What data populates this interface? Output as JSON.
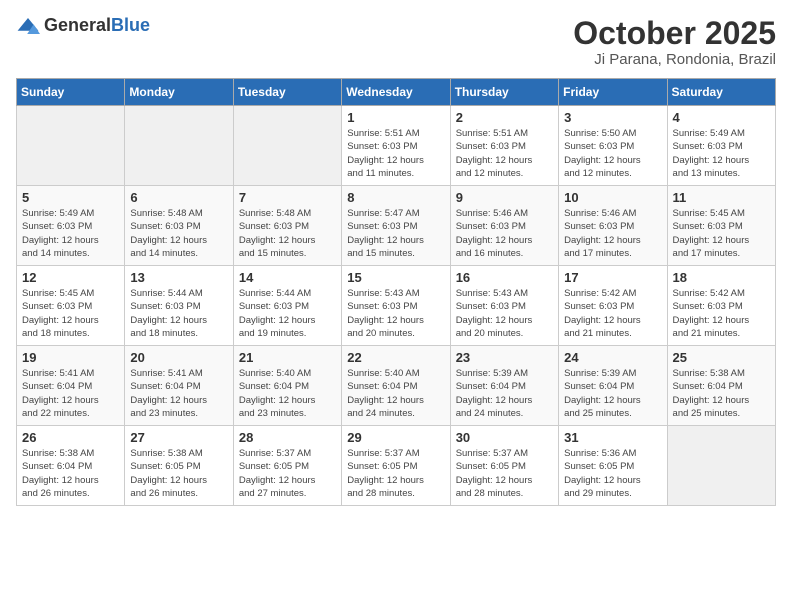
{
  "logo": {
    "general": "General",
    "blue": "Blue"
  },
  "header": {
    "title": "October 2025",
    "subtitle": "Ji Parana, Rondonia, Brazil"
  },
  "weekdays": [
    "Sunday",
    "Monday",
    "Tuesday",
    "Wednesday",
    "Thursday",
    "Friday",
    "Saturday"
  ],
  "weeks": [
    [
      {
        "day": "",
        "info": ""
      },
      {
        "day": "",
        "info": ""
      },
      {
        "day": "",
        "info": ""
      },
      {
        "day": "1",
        "info": "Sunrise: 5:51 AM\nSunset: 6:03 PM\nDaylight: 12 hours\nand 11 minutes."
      },
      {
        "day": "2",
        "info": "Sunrise: 5:51 AM\nSunset: 6:03 PM\nDaylight: 12 hours\nand 12 minutes."
      },
      {
        "day": "3",
        "info": "Sunrise: 5:50 AM\nSunset: 6:03 PM\nDaylight: 12 hours\nand 12 minutes."
      },
      {
        "day": "4",
        "info": "Sunrise: 5:49 AM\nSunset: 6:03 PM\nDaylight: 12 hours\nand 13 minutes."
      }
    ],
    [
      {
        "day": "5",
        "info": "Sunrise: 5:49 AM\nSunset: 6:03 PM\nDaylight: 12 hours\nand 14 minutes."
      },
      {
        "day": "6",
        "info": "Sunrise: 5:48 AM\nSunset: 6:03 PM\nDaylight: 12 hours\nand 14 minutes."
      },
      {
        "day": "7",
        "info": "Sunrise: 5:48 AM\nSunset: 6:03 PM\nDaylight: 12 hours\nand 15 minutes."
      },
      {
        "day": "8",
        "info": "Sunrise: 5:47 AM\nSunset: 6:03 PM\nDaylight: 12 hours\nand 15 minutes."
      },
      {
        "day": "9",
        "info": "Sunrise: 5:46 AM\nSunset: 6:03 PM\nDaylight: 12 hours\nand 16 minutes."
      },
      {
        "day": "10",
        "info": "Sunrise: 5:46 AM\nSunset: 6:03 PM\nDaylight: 12 hours\nand 17 minutes."
      },
      {
        "day": "11",
        "info": "Sunrise: 5:45 AM\nSunset: 6:03 PM\nDaylight: 12 hours\nand 17 minutes."
      }
    ],
    [
      {
        "day": "12",
        "info": "Sunrise: 5:45 AM\nSunset: 6:03 PM\nDaylight: 12 hours\nand 18 minutes."
      },
      {
        "day": "13",
        "info": "Sunrise: 5:44 AM\nSunset: 6:03 PM\nDaylight: 12 hours\nand 18 minutes."
      },
      {
        "day": "14",
        "info": "Sunrise: 5:44 AM\nSunset: 6:03 PM\nDaylight: 12 hours\nand 19 minutes."
      },
      {
        "day": "15",
        "info": "Sunrise: 5:43 AM\nSunset: 6:03 PM\nDaylight: 12 hours\nand 20 minutes."
      },
      {
        "day": "16",
        "info": "Sunrise: 5:43 AM\nSunset: 6:03 PM\nDaylight: 12 hours\nand 20 minutes."
      },
      {
        "day": "17",
        "info": "Sunrise: 5:42 AM\nSunset: 6:03 PM\nDaylight: 12 hours\nand 21 minutes."
      },
      {
        "day": "18",
        "info": "Sunrise: 5:42 AM\nSunset: 6:03 PM\nDaylight: 12 hours\nand 21 minutes."
      }
    ],
    [
      {
        "day": "19",
        "info": "Sunrise: 5:41 AM\nSunset: 6:04 PM\nDaylight: 12 hours\nand 22 minutes."
      },
      {
        "day": "20",
        "info": "Sunrise: 5:41 AM\nSunset: 6:04 PM\nDaylight: 12 hours\nand 23 minutes."
      },
      {
        "day": "21",
        "info": "Sunrise: 5:40 AM\nSunset: 6:04 PM\nDaylight: 12 hours\nand 23 minutes."
      },
      {
        "day": "22",
        "info": "Sunrise: 5:40 AM\nSunset: 6:04 PM\nDaylight: 12 hours\nand 24 minutes."
      },
      {
        "day": "23",
        "info": "Sunrise: 5:39 AM\nSunset: 6:04 PM\nDaylight: 12 hours\nand 24 minutes."
      },
      {
        "day": "24",
        "info": "Sunrise: 5:39 AM\nSunset: 6:04 PM\nDaylight: 12 hours\nand 25 minutes."
      },
      {
        "day": "25",
        "info": "Sunrise: 5:38 AM\nSunset: 6:04 PM\nDaylight: 12 hours\nand 25 minutes."
      }
    ],
    [
      {
        "day": "26",
        "info": "Sunrise: 5:38 AM\nSunset: 6:04 PM\nDaylight: 12 hours\nand 26 minutes."
      },
      {
        "day": "27",
        "info": "Sunrise: 5:38 AM\nSunset: 6:05 PM\nDaylight: 12 hours\nand 26 minutes."
      },
      {
        "day": "28",
        "info": "Sunrise: 5:37 AM\nSunset: 6:05 PM\nDaylight: 12 hours\nand 27 minutes."
      },
      {
        "day": "29",
        "info": "Sunrise: 5:37 AM\nSunset: 6:05 PM\nDaylight: 12 hours\nand 28 minutes."
      },
      {
        "day": "30",
        "info": "Sunrise: 5:37 AM\nSunset: 6:05 PM\nDaylight: 12 hours\nand 28 minutes."
      },
      {
        "day": "31",
        "info": "Sunrise: 5:36 AM\nSunset: 6:05 PM\nDaylight: 12 hours\nand 29 minutes."
      },
      {
        "day": "",
        "info": ""
      }
    ]
  ]
}
